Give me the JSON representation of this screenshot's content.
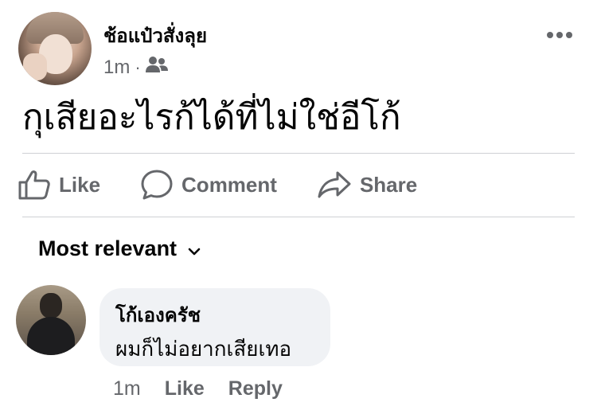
{
  "post": {
    "author": "ช้อแป๋วสั่งลุย",
    "time": "1m",
    "separator": "·",
    "audience_icon": "friends-icon",
    "more_icon": "more-horizontal-icon",
    "text": "กุเสียอะไรก้ได้ที่ไม่ใช่อีโก้"
  },
  "actions": {
    "like": "Like",
    "comment": "Comment",
    "share": "Share"
  },
  "comments_sort": {
    "label": "Most relevant",
    "icon": "chevron-down-icon"
  },
  "comment": {
    "author": "โก้เองครัช",
    "text": "ผมก็ไม่อยากเสียเทอ",
    "time": "1m",
    "like": "Like",
    "reply": "Reply"
  },
  "colors": {
    "secondary_text": "#65676b",
    "bubble_bg": "#f0f2f5",
    "divider": "#ced0d4"
  }
}
